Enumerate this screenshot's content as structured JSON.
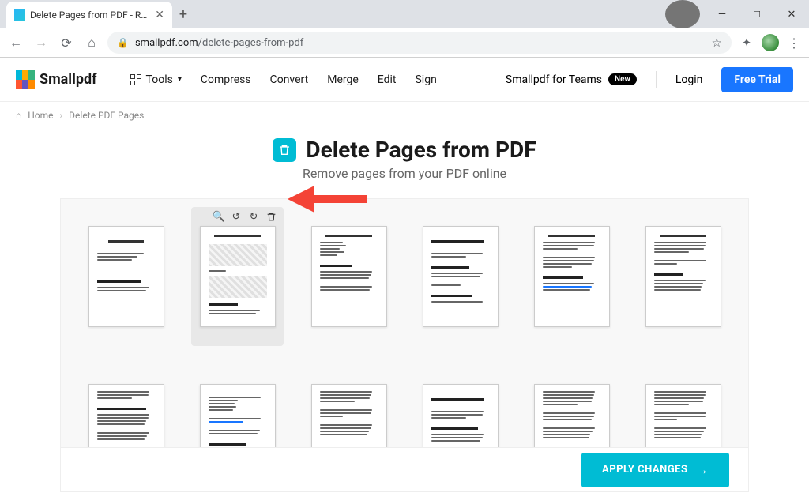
{
  "browser": {
    "tab_title": "Delete Pages from PDF - Remove",
    "url_domain": "smallpdf.com",
    "url_path": "/delete-pages-from-pdf"
  },
  "header": {
    "brand": "Smallpdf",
    "tools_label": "Tools",
    "nav": {
      "compress": "Compress",
      "convert": "Convert",
      "merge": "Merge",
      "edit": "Edit",
      "sign": "Sign"
    },
    "teams_label": "Smallpdf for Teams",
    "badge_new": "New",
    "login": "Login",
    "trial": "Free Trial"
  },
  "breadcrumb": {
    "home": "Home",
    "current": "Delete PDF Pages"
  },
  "hero": {
    "title": "Delete Pages from PDF",
    "subtitle": "Remove pages from your PDF online"
  },
  "page_tools": {
    "zoom": "zoom-in",
    "rotate_left": "rotate-left",
    "rotate_right": "rotate-right",
    "delete": "delete"
  },
  "apply": {
    "label": "APPLY CHANGES"
  },
  "colors": {
    "accent": "#00bcd4",
    "primary": "#1976ff",
    "annotation": "#f44336"
  }
}
